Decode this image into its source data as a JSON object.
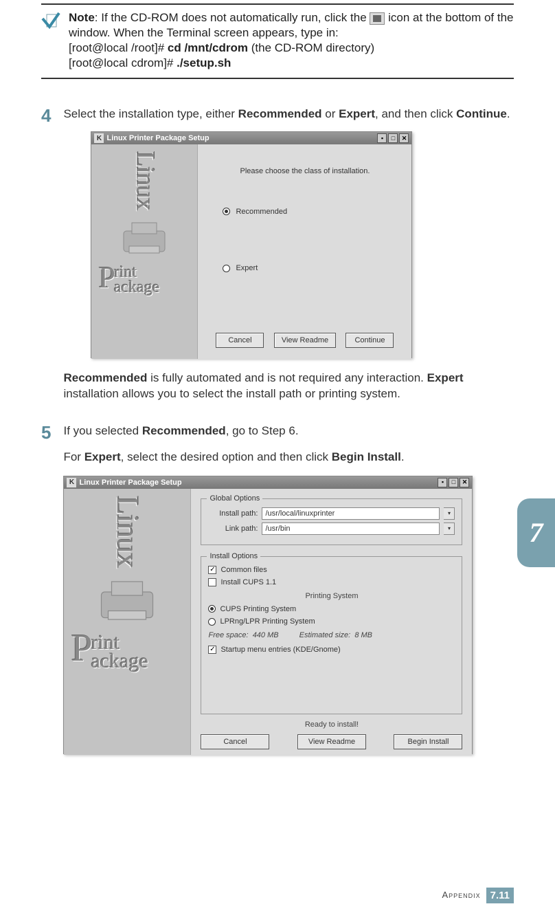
{
  "note": {
    "label": "Note",
    "text1": ": If the CD-ROM does not automatically run, click the ",
    "text2": " icon at the bottom of the window. When the Terminal screen appears, type in:",
    "line2_a": "[root@local /root]# ",
    "line2_b": "cd /mnt/cdrom",
    "line2_c": " (the CD-ROM directory)",
    "line3_a": "[root@local cdrom]# ",
    "line3_b": "./setup.sh"
  },
  "step4": {
    "num": "4",
    "text_a": "Select the installation type, either ",
    "text_b": "Recommended",
    "text_c": " or ",
    "text_d": "Expert",
    "text_e": ", and then click ",
    "text_f": "Continue",
    "text_g": ".",
    "post_a": "Recommended",
    "post_b": " is fully automated and is not required any interaction. ",
    "post_c": "Expert",
    "post_d": " installation allows you to select the install path or printing system."
  },
  "win1": {
    "title": "Linux Printer Package Setup",
    "k": "K",
    "prompt": "Please choose the class of installation.",
    "opt1": "Recommended",
    "opt2": "Expert",
    "btn_cancel": "Cancel",
    "btn_readme": "View Readme",
    "btn_continue": "Continue",
    "side_linux": "Linux",
    "side_p1": "P",
    "side_p2": "rint",
    "side_p3": "ackage"
  },
  "step5": {
    "num": "5",
    "text_a": "If you selected ",
    "text_b": "Recommended",
    "text_c": ", go to Step 6.",
    "text2_a": "For ",
    "text2_b": "Expert",
    "text2_c": ", select the desired option and then click ",
    "text2_d": "Begin Install",
    "text2_e": "."
  },
  "win2": {
    "title": "Linux Printer Package Setup",
    "k": "K",
    "global_legend": "Global Options",
    "install_path_label": "Install path:",
    "install_path_val": "/usr/local/linuxprinter",
    "link_path_label": "Link path:",
    "link_path_val": "/usr/bin",
    "install_legend": "Install Options",
    "chk_common": "Common files",
    "chk_cups": "Install CUPS 1.1",
    "printing_system": "Printing System",
    "radio_cups": "CUPS Printing System",
    "radio_lprng": "LPRng/LPR Printing System",
    "free_space_label": "Free space:",
    "free_space_val": "440 MB",
    "est_label": "Estimated size:",
    "est_val": "8 MB",
    "chk_startup": "Startup menu entries (KDE/Gnome)",
    "ready": "Ready to install!",
    "btn_cancel": "Cancel",
    "btn_readme": "View Readme",
    "btn_begin": "Begin Install",
    "side_linux": "Linux",
    "side_p1": "P",
    "side_p2": "rint",
    "side_p3": "ackage"
  },
  "chapter_tab": "7",
  "footer": {
    "label": "Appendix",
    "page_major": "7",
    "page_minor": "11"
  }
}
